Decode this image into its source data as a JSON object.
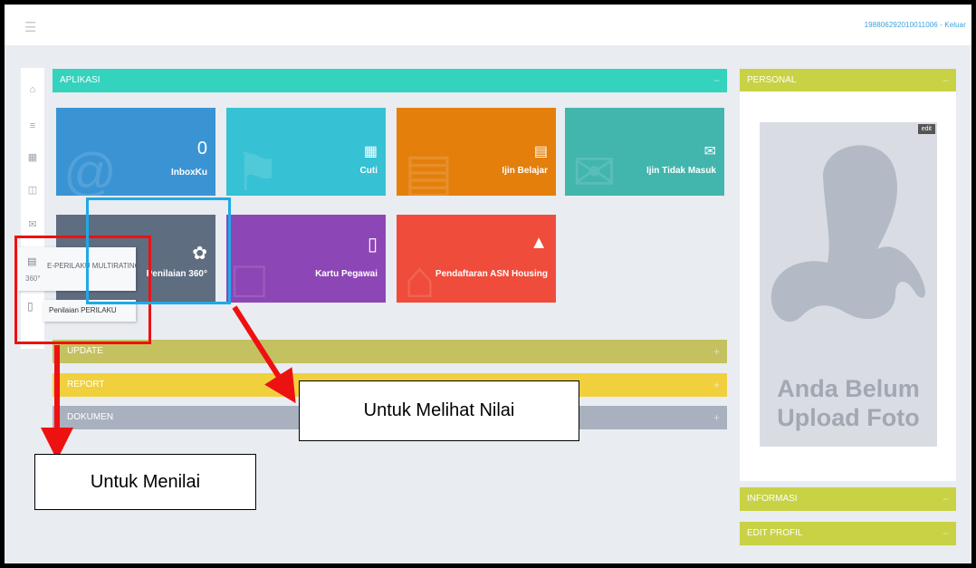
{
  "topbar": {
    "menu_icon": "hamburger-icon",
    "user_text": "198806292010011006 - Keluar"
  },
  "sidebar_rail": {
    "icons": [
      "home-icon",
      "layers-icon",
      "calendar-icon",
      "document-icon",
      "mail-icon"
    ]
  },
  "aplikasi": {
    "title": "APLIKASI",
    "collapse": "−",
    "color": "#34d3bd",
    "tiles": [
      {
        "label": "InboxKu",
        "count": "0",
        "color": "#3a94d4"
      },
      {
        "label": "Cuti",
        "icon": "calendar-icon",
        "color": "#36c1d4"
      },
      {
        "label": "Ijin Belajar",
        "icon": "book-icon",
        "color": "#e47f0c"
      },
      {
        "label": "Ijin Tidak Masuk",
        "icon": "mail-icon",
        "color": "#42b5ad"
      },
      {
        "label": "Penilaian 360°",
        "icon": "tool-icon",
        "color": "#5f6d80"
      },
      {
        "label": "Kartu Pegawai",
        "icon": "notebook-icon",
        "color": "#8d46b5"
      },
      {
        "label": "Pendaftaran ASN Housing",
        "icon": "home-icon",
        "color": "#ef4c3b"
      }
    ]
  },
  "perilaku_menu": {
    "badge": "360°",
    "title": "E-PERILAKU MULTIRATING",
    "sub_item": "Penilaian PERILAKU"
  },
  "sections": [
    {
      "title": "UPDATE",
      "toggle": "+",
      "color": "#c4c160"
    },
    {
      "title": "REPORT",
      "toggle": "+",
      "color": "#f1d03e"
    },
    {
      "title": "DOKUMEN",
      "toggle": "+",
      "color": "#a9b1bf"
    }
  ],
  "personal": {
    "title": "PERSONAL",
    "toggle": "−",
    "edit": "edit",
    "no_photo_line1": "Anda Belum",
    "no_photo_line2": "Upload Foto"
  },
  "informasi": {
    "title": "INFORMASI",
    "toggle": "−"
  },
  "edit_profil": {
    "title": "EDIT PROFIL",
    "toggle": "−"
  },
  "annotations": {
    "melihat": "Untuk Melihat Nilai",
    "menilai": "Untuk Menilai"
  },
  "colors": {
    "accent_red": "#ee1111",
    "accent_blue": "#1fa9e6",
    "personal_bar": "#c8d244"
  }
}
